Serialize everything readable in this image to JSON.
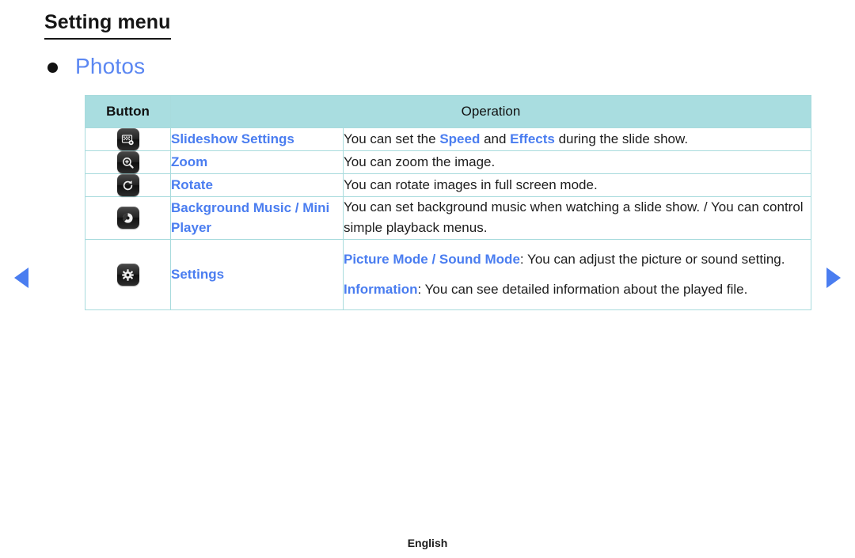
{
  "page": {
    "title": "Setting menu",
    "section_bullet_icon": "bullet-dot-icon",
    "section_title": "Photos",
    "footer_language": "English",
    "accent_blue": "#4a7df0",
    "header_teal": "#a9dde0",
    "border_teal": "#a8dbdd"
  },
  "nav": {
    "prev_icon": "triangle-left-icon",
    "next_icon": "triangle-right-icon"
  },
  "table": {
    "headers": {
      "button": "Button",
      "operation": "Operation"
    },
    "rows": [
      {
        "icon": "slideshow-settings-icon",
        "name": "Slideshow Settings",
        "desc_parts": [
          {
            "text": "You can set the ",
            "highlight": false
          },
          {
            "text": "Speed",
            "highlight": true
          },
          {
            "text": " and ",
            "highlight": false
          },
          {
            "text": "Effects",
            "highlight": true
          },
          {
            "text": " during the slide show.",
            "highlight": false
          }
        ]
      },
      {
        "icon": "zoom-in-icon",
        "name": "Zoom",
        "desc_parts": [
          {
            "text": "You can zoom the image.",
            "highlight": false
          }
        ]
      },
      {
        "icon": "rotate-icon",
        "name": "Rotate",
        "desc_parts": [
          {
            "text": "You can rotate images in full screen mode.",
            "highlight": false
          }
        ]
      },
      {
        "icon": "background-music-icon",
        "name": "Background Music / Mini Player",
        "desc_parts": [
          {
            "text": "You can set background music when watching a slide show. / You can control simple playback menus.",
            "highlight": false
          }
        ]
      },
      {
        "icon": "settings-gear-icon",
        "name": "Settings",
        "desc_paragraphs": [
          [
            {
              "text": "Picture Mode / Sound Mode",
              "highlight": true
            },
            {
              "text": ": You can adjust the picture or sound setting.",
              "highlight": false
            }
          ],
          [
            {
              "text": "Information",
              "highlight": true
            },
            {
              "text": ": You can see detailed information about the played file.",
              "highlight": false
            }
          ]
        ]
      }
    ]
  }
}
